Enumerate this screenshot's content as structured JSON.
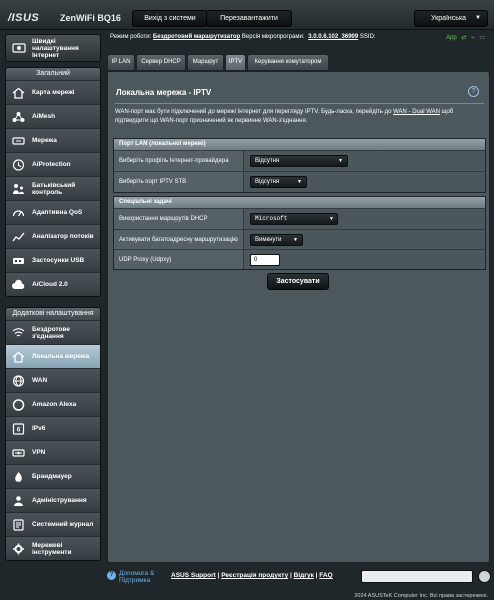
{
  "header": {
    "logo": "/ISUS",
    "model": "ZenWiFi BQ16",
    "logout_label": "Вихід з системи",
    "reboot_label": "Перезавантажити",
    "language": "Українська"
  },
  "status": {
    "mode_label": "Режим роботи:",
    "mode_value": "Бездротовий маршрутизатор",
    "firmware_label": "Версія мікропрограми:",
    "firmware_value": "3.0.0.6.102_36909",
    "ssid_label": "SSID:",
    "app_label": "App"
  },
  "sidebar": {
    "qis_label": "Швидкі налаштування Інтернет",
    "general_title": "Загальний",
    "general_items": [
      {
        "label": "Карта мережі",
        "icon": "network-map-icon"
      },
      {
        "label": "AiMesh",
        "icon": "aimesh-icon"
      },
      {
        "label": "Мережа",
        "icon": "network-icon"
      },
      {
        "label": "AiProtection",
        "icon": "shield-icon"
      },
      {
        "label": "Батьківський контроль",
        "icon": "parental-control-icon"
      },
      {
        "label": "Адаптивна QoS",
        "icon": "qos-gauge-icon"
      },
      {
        "label": "Аналізатор потоків",
        "icon": "traffic-analyzer-icon"
      },
      {
        "label": "Застосунки USB",
        "icon": "usb-icon"
      },
      {
        "label": "AiCloud 2.0",
        "icon": "cloud-icon"
      }
    ],
    "advanced_title": "Додаткові налаштування",
    "advanced_items": [
      {
        "label": "Бездротове з'єднання",
        "icon": "wireless-icon"
      },
      {
        "label": "Локальна мережа",
        "icon": "lan-icon"
      },
      {
        "label": "WAN",
        "icon": "globe-icon"
      },
      {
        "label": "Amazon Alexa",
        "icon": "alexa-icon"
      },
      {
        "label": "IPv6",
        "icon": "ipv6-icon"
      },
      {
        "label": "VPN",
        "icon": "vpn-icon"
      },
      {
        "label": "Брандмауер",
        "icon": "firewall-icon"
      },
      {
        "label": "Адміністрування",
        "icon": "administration-icon"
      },
      {
        "label": "Системний журнал",
        "icon": "system-log-icon"
      },
      {
        "label": "Мережеві інструменти",
        "icon": "network-tools-icon"
      }
    ]
  },
  "tabs": [
    "IP LAN",
    "Сервер DHCP",
    "Маршрут",
    "IPTV",
    "Керування комутатором"
  ],
  "active_tab": "IPTV",
  "page": {
    "title": "Локальна мережа - IPTV",
    "description_pre": "WAN-порт має бути підключений до мережі Інтернет для перегляду IPTV. Будь-ласка, перейдіть до ",
    "description_link": "WAN - Dual WAN",
    "description_post": " щоб підтвердити що WAN-порт призначений як первинне WAN-з'єднання."
  },
  "lan_port": {
    "heading": "Порт LAN (локальної мережі)",
    "isp_profile_label": "Виберіть профіль Інтернет-провайдера",
    "isp_profile_value": "Відсутня",
    "iptv_stb_label": "Виберіть порт IPTV STB",
    "iptv_stb_value": "Відсутня"
  },
  "special": {
    "heading": "Спеціальні задачі",
    "dhcp_routes_label": "Використання маршрутів DHCP",
    "dhcp_routes_value": "Microsoft",
    "multicast_label": "Активувати багатоадресну маршрутизацію",
    "multicast_value": "Вимкнути",
    "udpxy_label": "UDP Proxy (Udpxy)",
    "udpxy_value": "0"
  },
  "apply_label": "Застосувати",
  "footer": {
    "help_label": "Допомога & Підтримка",
    "links": [
      "ASUS Support",
      "Реєстрація продукту",
      "Відгук",
      "FAQ"
    ],
    "copyright": "2024 ASUSTeK Computer Inc. Всі права застережені."
  },
  "colors": {
    "background": "#20272a",
    "panel": "#4d585d",
    "active_nav": "#a6bdcc",
    "link": "#6fb1e8",
    "status_green": "#63c35a"
  }
}
